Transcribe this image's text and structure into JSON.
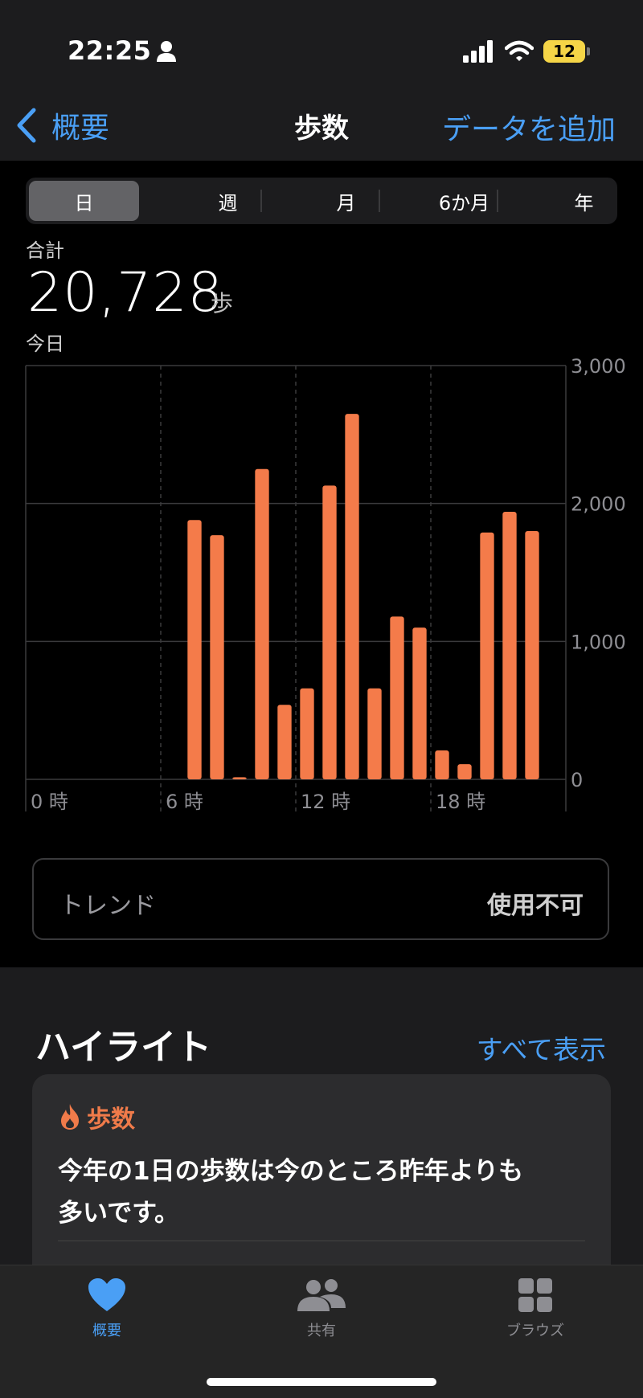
{
  "status": {
    "time": "22:25",
    "battery": "12"
  },
  "nav": {
    "back_label": "概要",
    "title": "歩数",
    "add_label": "データを追加"
  },
  "segments": [
    "日",
    "週",
    "月",
    "6か月",
    "年"
  ],
  "active_segment": "日",
  "summary": {
    "label": "合計",
    "value": "20,728",
    "unit": "歩",
    "date": "今日"
  },
  "chart_data": {
    "type": "bar",
    "x": [
      7,
      8,
      9,
      10,
      11,
      12,
      13,
      14,
      15,
      16,
      17,
      18,
      19,
      20,
      21,
      22,
      23
    ],
    "values": [
      1880,
      1770,
      15,
      2250,
      540,
      660,
      2130,
      2650,
      660,
      1180,
      1100,
      210,
      110,
      1790,
      1940,
      1800,
      0
    ],
    "x_tick_labels": [
      "0 時",
      "6 時",
      "12 時",
      "18 時"
    ],
    "x_ticks": [
      0,
      6,
      12,
      18
    ],
    "y_tick_labels": [
      "0",
      "1,000",
      "2,000",
      "3,000"
    ],
    "y_ticks": [
      0,
      1000,
      2000,
      3000
    ],
    "ylim": [
      0,
      3000
    ],
    "xlim": [
      0,
      24
    ],
    "color": "#f47b4a",
    "grid": true
  },
  "trend": {
    "label": "トレンド",
    "value": "使用不可"
  },
  "highlights": {
    "title": "ハイライト",
    "show_all": "すべて表示",
    "card": {
      "category": "歩数",
      "text": "今年の1日の歩数は今のところ昨年よりも多いです。"
    }
  },
  "tabs": [
    {
      "label": "概要",
      "icon": "heart-icon",
      "active": true
    },
    {
      "label": "共有",
      "icon": "people-icon",
      "active": false
    },
    {
      "label": "ブラウズ",
      "icon": "grid-icon",
      "active": false
    }
  ],
  "colors": {
    "accent": "#4a9ff5",
    "bar": "#f47b4a",
    "highlight": "#f07b4a"
  }
}
